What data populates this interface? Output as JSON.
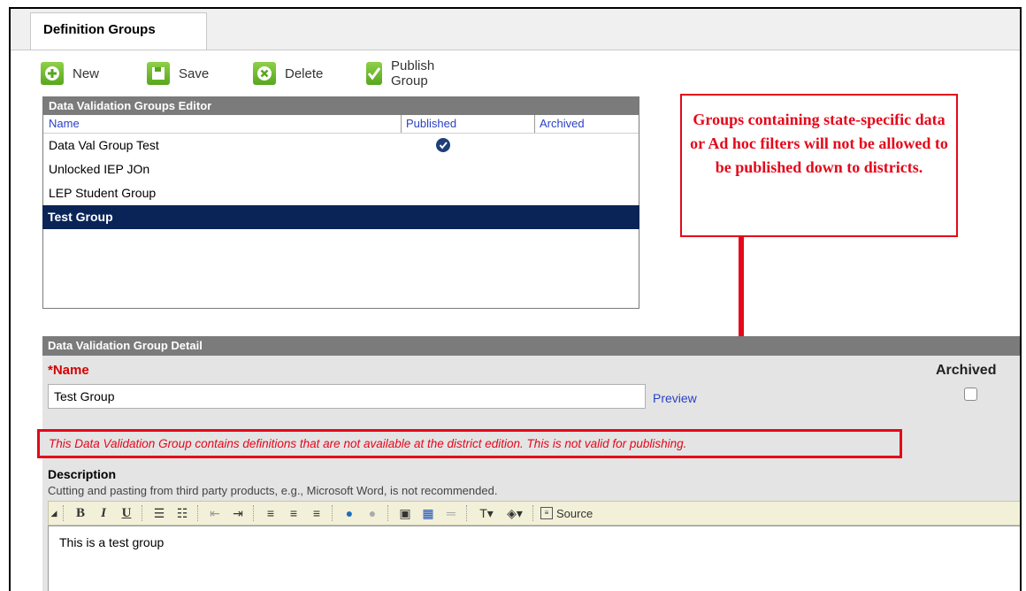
{
  "tab": {
    "label": "Definition Groups"
  },
  "toolbar": {
    "new_label": "New",
    "save_label": "Save",
    "delete_label": "Delete",
    "publish_label": "Publish Group"
  },
  "groups_editor": {
    "title": "Data Validation Groups Editor",
    "columns": {
      "name": "Name",
      "published": "Published",
      "archived": "Archived"
    },
    "rows": [
      {
        "name": "Data Val Group Test",
        "published": true
      },
      {
        "name": "Unlocked IEP JOn",
        "published": false
      },
      {
        "name": "LEP Student Group",
        "published": false
      },
      {
        "name": "Test Group",
        "published": false,
        "selected": true
      }
    ]
  },
  "callout": {
    "text": "Groups containing state-specific data or Ad hoc filters will not be allowed to be published down to districts.",
    "color": "#e4081a"
  },
  "detail": {
    "title": "Data Validation Group Detail",
    "name_label": "*Name",
    "name_value": "Test Group",
    "preview_link": "Preview",
    "archived_label": "Archived",
    "warning": "This Data Validation Group contains definitions that are not available at the district edition. This is not valid for publishing.",
    "description_label": "Description",
    "description_note": "Cutting and pasting from third party products, e.g., Microsoft Word, is not recommended.",
    "source_label": "Source",
    "description_text": "This is a test group"
  }
}
